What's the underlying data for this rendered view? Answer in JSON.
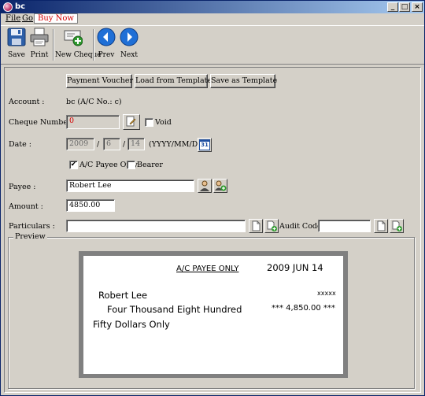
{
  "window": {
    "title": "bc",
    "btn_min": "_",
    "btn_max": "□",
    "btn_close": "×"
  },
  "menu": {
    "file": "File",
    "go": "Go",
    "buy_now": "Buy Now"
  },
  "toolbar": {
    "save": "Save",
    "print": "Print",
    "new_cheque": "New Cheque",
    "prev": "Prev",
    "next": "Next"
  },
  "actions": {
    "payment_voucher": "Payment Voucher",
    "load_template": "Load from Template",
    "save_template": "Save as Template"
  },
  "form": {
    "account_label": "Account :",
    "account_value": "bc (A/C No.: c)",
    "cheque_number_label": "Cheque Number :",
    "cheque_number_value": "0",
    "void_label": "Void",
    "date_label": "Date :",
    "date_year": "2009",
    "date_month": "6",
    "date_day": "14",
    "date_sep1": "/",
    "date_sep2": "/",
    "date_format": "(YYYY/MM/DD)",
    "calendar_icon_text": "31",
    "ac_payee_label": "A/C Payee Only",
    "ac_payee_checked": "✔",
    "bearer_label": "Bearer",
    "payee_label": "Payee :",
    "payee_value": "Robert Lee",
    "amount_label": "Amount :",
    "amount_value": "4850.00",
    "particulars_label": "Particulars :",
    "particulars_value": "",
    "audit_code_label": "Audit Code :",
    "audit_code_value": ""
  },
  "preview": {
    "group_title": "Preview",
    "crossing": "A/C PAYEE ONLY",
    "date": "2009 JUN 14",
    "payee": "Robert Lee",
    "masked": "xxxxx",
    "words_line1": "Four Thousand Eight Hundred",
    "amount_figure": "*** 4,850.00 ***",
    "words_line2": "Fifty Dollars Only"
  },
  "colors": {
    "buy_now": "#d40000",
    "cheque_number_text": "#d40000",
    "title_start": "#0a246a",
    "title_end": "#a6caf0",
    "nav_blue": "#1f6fd6"
  }
}
